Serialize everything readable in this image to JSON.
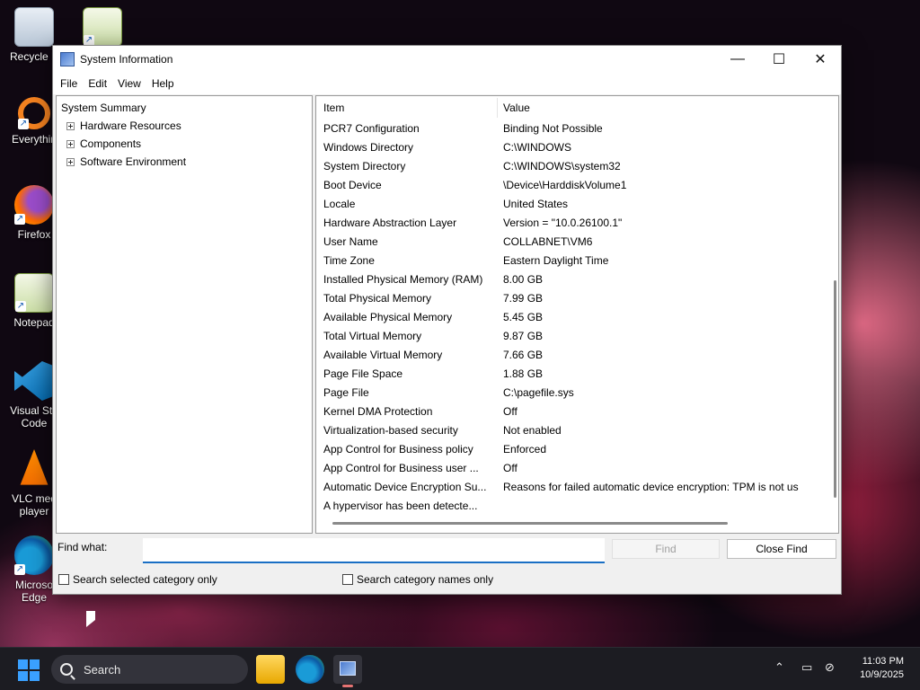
{
  "desktop": {
    "icons": [
      {
        "label": "Recycle B",
        "icon": "recycle-bin-icon"
      },
      {
        "label": "",
        "icon": "notepad-plus-icon"
      },
      {
        "label": "Everythin",
        "icon": "everything-search-icon"
      },
      {
        "label": "Firefox",
        "icon": "firefox-icon"
      },
      {
        "label": "Notepad",
        "icon": "notepad-icon"
      },
      {
        "label": "Visual Stu\nCode",
        "icon": "vscode-icon"
      },
      {
        "label": "VLC med\nplayer",
        "icon": "vlc-icon"
      },
      {
        "label": "Microso\nEdge",
        "icon": "edge-icon"
      }
    ]
  },
  "window": {
    "title": "System Information",
    "controls": {
      "minimize": "—",
      "maximize": "☐",
      "close": "✕"
    },
    "menu": [
      "File",
      "Edit",
      "View",
      "Help"
    ],
    "tree": {
      "root": "System Summary",
      "children": [
        "Hardware Resources",
        "Components",
        "Software Environment"
      ]
    },
    "list": {
      "headers": {
        "item": "Item",
        "value": "Value"
      },
      "rows": [
        {
          "item": "PCR7 Configuration",
          "value": "Binding Not Possible"
        },
        {
          "item": "Windows Directory",
          "value": "C:\\WINDOWS"
        },
        {
          "item": "System Directory",
          "value": "C:\\WINDOWS\\system32"
        },
        {
          "item": "Boot Device",
          "value": "\\Device\\HarddiskVolume1"
        },
        {
          "item": "Locale",
          "value": "United States"
        },
        {
          "item": "Hardware Abstraction Layer",
          "value": "Version = \"10.0.26100.1\""
        },
        {
          "item": "User Name",
          "value": "COLLABNET\\VM6"
        },
        {
          "item": "Time Zone",
          "value": "Eastern Daylight Time"
        },
        {
          "item": "Installed Physical Memory (RAM)",
          "value": "8.00 GB"
        },
        {
          "item": "Total Physical Memory",
          "value": "7.99 GB"
        },
        {
          "item": "Available Physical Memory",
          "value": "5.45 GB"
        },
        {
          "item": "Total Virtual Memory",
          "value": "9.87 GB"
        },
        {
          "item": "Available Virtual Memory",
          "value": "7.66 GB"
        },
        {
          "item": "Page File Space",
          "value": "1.88 GB"
        },
        {
          "item": "Page File",
          "value": "C:\\pagefile.sys"
        },
        {
          "item": "Kernel DMA Protection",
          "value": "Off"
        },
        {
          "item": "Virtualization-based security",
          "value": "Not enabled"
        },
        {
          "item": "App Control for Business policy",
          "value": "Enforced"
        },
        {
          "item": "App Control for Business user ...",
          "value": "Off"
        },
        {
          "item": "Automatic Device Encryption Su...",
          "value": "Reasons for failed automatic device encryption: TPM is not us"
        },
        {
          "item": "A hypervisor has been detecte...",
          "value": ""
        }
      ]
    },
    "find": {
      "label": "Find what:",
      "value": "",
      "find_button": "Find",
      "close_find_button": "Close Find",
      "search_selected": "Search selected category only",
      "search_names": "Search category names only"
    }
  },
  "taskbar": {
    "search_placeholder": "Search",
    "time": "11:03 PM",
    "date": "10/9/2025"
  }
}
